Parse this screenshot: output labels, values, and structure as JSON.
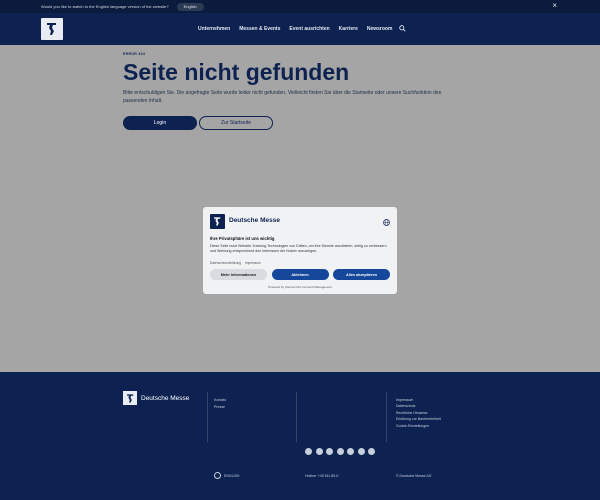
{
  "langbar": {
    "message": "Would you like to switch to the English language version of the website?",
    "button_label": "English",
    "close_icon": "close-icon"
  },
  "header": {
    "logo_icon": "deutsche-messe-logo-icon",
    "nav": [
      "Unternehmen",
      "Messen & Events",
      "Event ausrichten",
      "Karriere",
      "Newsroom"
    ],
    "search_icon": "search-icon"
  },
  "main": {
    "error_code": "ERROR 404",
    "title": "Seite nicht gefunden",
    "description": "Bitte entschuldigen Sie. Die angefragte Seite wurde leider nicht gefunden. Vielleicht finden Sie über die Startseite oder unsere Suchfunktion den passenden Inhalt.",
    "login_label": "Login",
    "home_label": "Zur Startseite"
  },
  "consent": {
    "brand": "Deutsche Messe",
    "title": "Ihre Privatsphäre ist uns wichtig",
    "text": "Diese Seite nutzt Website-Tracking-Technologien von Dritten, um ihre Dienste anzubieten, stetig zu verbessern und Werbung entsprechend den Interessen der Nutzer anzuzeigen.",
    "links": [
      "Datenschutzerklärung",
      "Impressum"
    ],
    "more_label": "Mehr Informationen",
    "deny_label": "Ablehnen",
    "accept_label": "Alles akzeptieren",
    "powered": "Powered by Usercentrics Consent Management"
  },
  "footer": {
    "brand": "Deutsche Messe",
    "col1": [
      "Kontakt",
      "Presse"
    ],
    "col2": [
      "Impressum",
      "Datenschutz",
      "Rechtliche Hinweise",
      "Erklärung zur Barrierefreiheit",
      "Cookie-Einstellungen"
    ],
    "language": "ENGLISH",
    "phone": "Hotline: +49 511 89-0",
    "copyright": "© Deutsche Messe AG",
    "social_icons": [
      "facebook-icon",
      "x-icon",
      "instagram-icon",
      "youtube-icon",
      "xing-icon",
      "linkedin-icon",
      "tiktok-icon"
    ]
  }
}
